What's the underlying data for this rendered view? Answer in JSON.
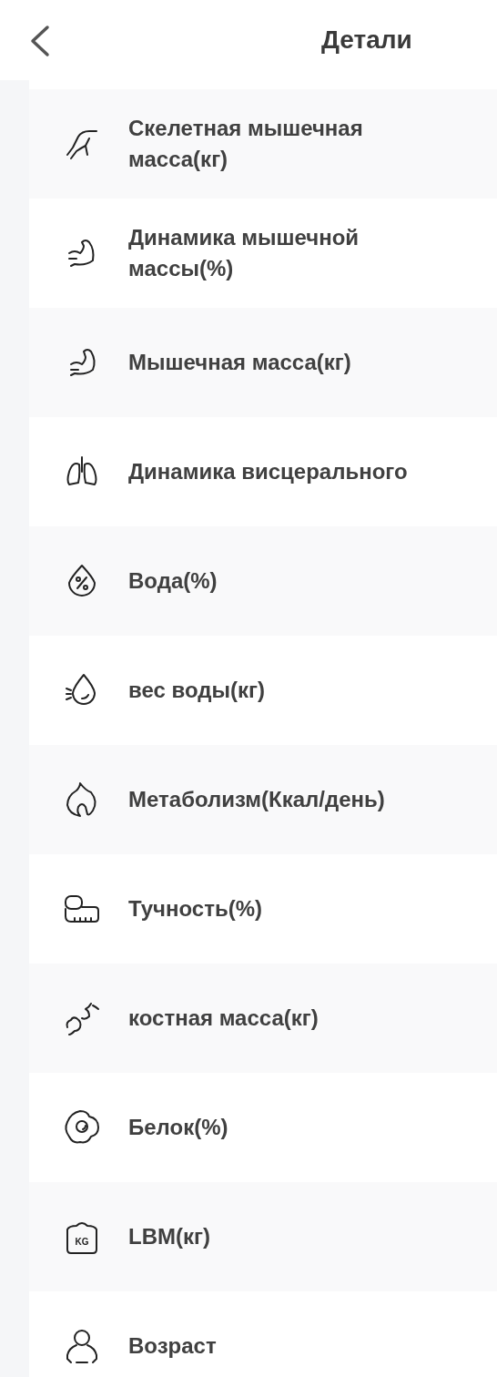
{
  "header": {
    "title": "Детали"
  },
  "items": [
    {
      "label": "Скелетная мышечная масса(кг)"
    },
    {
      "label": "Динамика мышечной массы(%)"
    },
    {
      "label": "Мышечная масса(кг)"
    },
    {
      "label": "Динамика висцерального"
    },
    {
      "label": "Вода(%)"
    },
    {
      "label": "вес воды(кг)"
    },
    {
      "label": "Метаболизм(Ккал/день)"
    },
    {
      "label": "Тучность(%)"
    },
    {
      "label": "костная масса(кг)"
    },
    {
      "label": "Белок(%)"
    },
    {
      "label": "LBM(кг)",
      "icon_text": "KG"
    },
    {
      "label": "Возраст"
    }
  ]
}
